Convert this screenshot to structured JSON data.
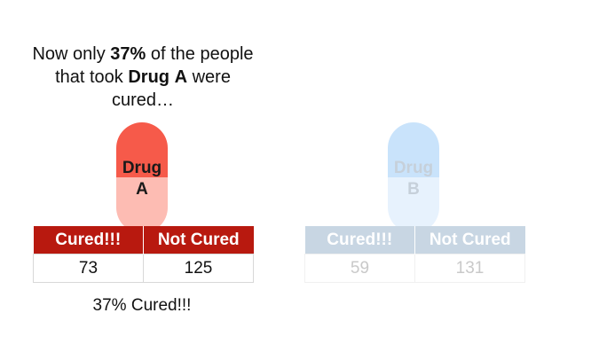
{
  "caption": {
    "pre": "Now only ",
    "percent": "37%",
    "mid": " of the people that took ",
    "drug_word": "Drug",
    "space": " ",
    "drug_letter": "A",
    "post": " were cured…"
  },
  "drugs": [
    {
      "label_line1": "Drug",
      "label_line2": "A",
      "headers": [
        "Cured!!!",
        "Not Cured"
      ],
      "values": [
        "73",
        "125"
      ],
      "summary": "37% Cured!!!",
      "color": "#b8190f",
      "pill_top_color": "#f65a4a",
      "pill_bottom_color": "#fdbcb3"
    },
    {
      "label_line1": "Drug",
      "label_line2": "B",
      "headers": [
        "Cured!!!",
        "Not Cured"
      ],
      "values": [
        "59",
        "131"
      ],
      "color": "#c8d6e3",
      "pill_top_color": "#c9e3fb",
      "pill_bottom_color": "#e7f2fd"
    }
  ]
}
